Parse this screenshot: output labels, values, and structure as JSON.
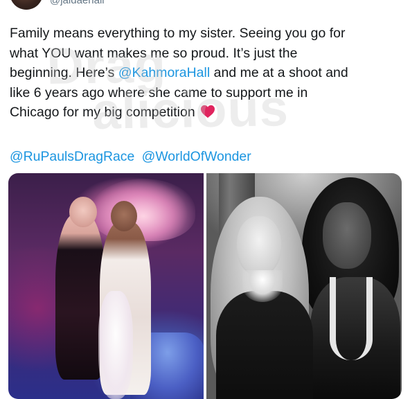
{
  "header": {
    "handle": "@jaidaehall"
  },
  "tweet": {
    "line1": "Family means everything to my sister. Seeing you go for",
    "line2": "what YOU want makes me so proud. It’s just the",
    "line3_a": "beginning. Here’s ",
    "line3_mention": "@KahmoraHall",
    "line3_b": " and me at a shoot and",
    "line4": "like 6 years ago where she came to support me in",
    "line5": "Chicago for my big competition",
    "heart_icon": "red-heart-emoji",
    "heart_color": "#e0245e",
    "mentions": [
      "@RuPaulsDragRace",
      "@WorldOfWonder"
    ]
  },
  "watermark": {
    "text": "Dragalicious"
  },
  "colors": {
    "link": "#1b95e0",
    "text": "#14171a"
  }
}
